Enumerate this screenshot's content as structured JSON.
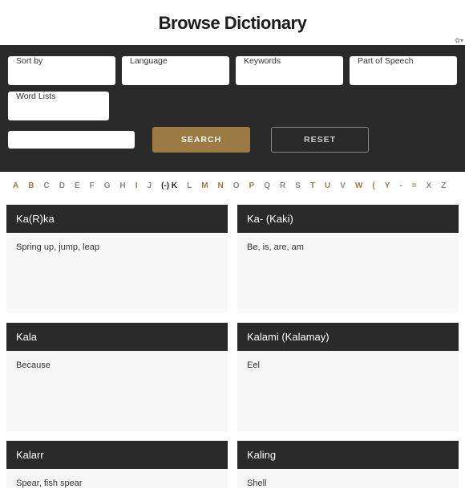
{
  "title": "Browse Dictionary",
  "filters": {
    "sort": "Sort by",
    "language": "Language",
    "keywords": "Keywords",
    "pos": "Part of Speech",
    "wordlists": "Word Lists"
  },
  "buttons": {
    "search": "Search",
    "reset": "Reset"
  },
  "alphabet": [
    {
      "ch": "A",
      "state": "active"
    },
    {
      "ch": "B",
      "state": "active"
    },
    {
      "ch": "C",
      "state": ""
    },
    {
      "ch": "D",
      "state": ""
    },
    {
      "ch": "E",
      "state": ""
    },
    {
      "ch": "F",
      "state": ""
    },
    {
      "ch": "G",
      "state": ""
    },
    {
      "ch": "H",
      "state": ""
    },
    {
      "ch": "I",
      "state": "active"
    },
    {
      "ch": "J",
      "state": ""
    },
    {
      "ch": "(-) K",
      "state": "current"
    },
    {
      "ch": "L",
      "state": ""
    },
    {
      "ch": "M",
      "state": "active"
    },
    {
      "ch": "N",
      "state": "active"
    },
    {
      "ch": "O",
      "state": ""
    },
    {
      "ch": "P",
      "state": "active"
    },
    {
      "ch": "Q",
      "state": ""
    },
    {
      "ch": "R",
      "state": ""
    },
    {
      "ch": "S",
      "state": ""
    },
    {
      "ch": "T",
      "state": "active"
    },
    {
      "ch": "U",
      "state": "active"
    },
    {
      "ch": "V",
      "state": ""
    },
    {
      "ch": "W",
      "state": "active"
    },
    {
      "ch": "(",
      "state": "active"
    },
    {
      "ch": "Y",
      "state": "active"
    },
    {
      "ch": "-",
      "state": "active"
    },
    {
      "ch": "=",
      "state": "active"
    },
    {
      "ch": "X",
      "state": ""
    },
    {
      "ch": "Z",
      "state": ""
    }
  ],
  "entries": [
    {
      "word": "Ka(R)ka",
      "def": "Spring up, jump, leap",
      "size": "tall"
    },
    {
      "word": "Ka- (Kaki)",
      "def": "Be, is, are, am",
      "size": "tall"
    },
    {
      "word": "Kala",
      "def": "Because",
      "size": "tall"
    },
    {
      "word": "Kalami (Kalamay)",
      "def": "Eel",
      "size": "tall"
    },
    {
      "word": "Kalarr",
      "def": "Spear, fish spear",
      "size": "short"
    },
    {
      "word": "Kaling",
      "def": "Shell",
      "size": "short"
    }
  ]
}
